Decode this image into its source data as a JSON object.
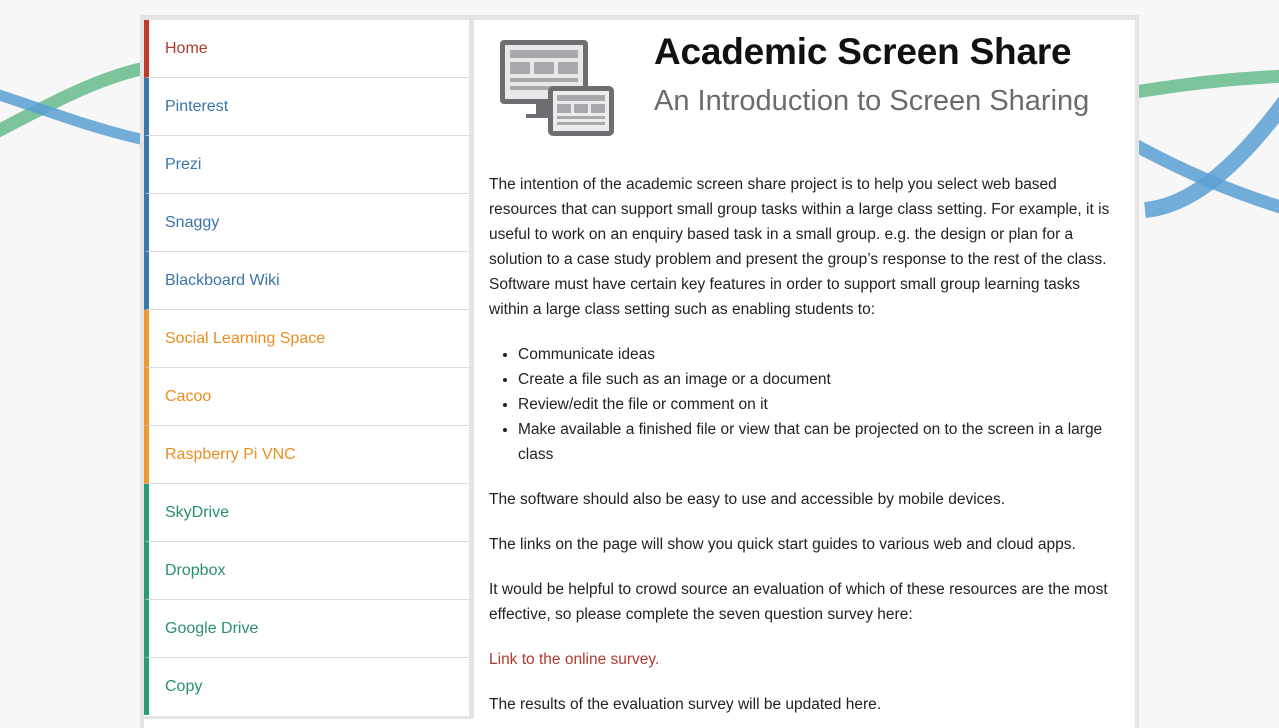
{
  "sidebar": {
    "items": [
      {
        "label": "Home",
        "color": "#c0392b"
      },
      {
        "label": "Pinterest",
        "color": "#3a77ad"
      },
      {
        "label": "Prezi",
        "color": "#3a77ad"
      },
      {
        "label": "Snaggy",
        "color": "#3a77ad"
      },
      {
        "label": "Blackboard Wiki",
        "color": "#3a77ad"
      },
      {
        "label": "Social Learning Space",
        "color": "#ee9a2e"
      },
      {
        "label": "Cacoo",
        "color": "#ee9a2e"
      },
      {
        "label": "Raspberry Pi VNC",
        "color": "#ee9a2e"
      },
      {
        "label": "SkyDrive",
        "color": "#2a9a78"
      },
      {
        "label": "Dropbox",
        "color": "#2a9a78"
      },
      {
        "label": "Google Drive",
        "color": "#2a9a78"
      },
      {
        "label": "Copy",
        "color": "#2a9a78"
      }
    ]
  },
  "header": {
    "logo_icon": "screens-icon",
    "title": "Academic Screen Share",
    "subtitle": "An Introduction to Screen Sharing"
  },
  "content": {
    "intro": "The intention of the academic screen share project is to help you select web based resources that can support small group tasks within a large class setting. For example, it is useful to work on an enquiry based task in a small group. e.g. the design or plan for a solution to a case study problem and present the group’s response to the rest of the class. Software must have certain key features in order to support small group learning tasks within a large class setting such as enabling students to:",
    "bullets": [
      "Communicate ideas",
      "Create a file such as an image or a document",
      "Review/edit the file or comment on it",
      "Make available a finished file or view that can be projected on to the screen in a large class"
    ],
    "p_mobile": "The software should also be easy to use and accessible by mobile devices.",
    "p_links": "The links on the page will show you quick start guides to various web and cloud apps.",
    "p_survey": "It would be helpful to crowd source an evaluation of which of these resources are the most effective, so please complete the seven question survey here:",
    "survey_link": "Link to the online survey.",
    "p_results": "The results of the evaluation survey will be updated here."
  },
  "colors": {
    "background": "#f7f7f7",
    "ribbon_green": "#7cc49c",
    "ribbon_blue": "#5b9fd4",
    "link_red": "#b03a2e"
  }
}
